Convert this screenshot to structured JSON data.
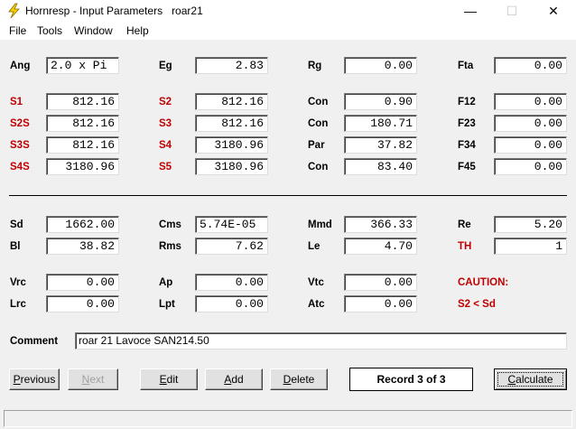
{
  "window": {
    "title": "Hornresp - Input Parameters   roar21",
    "minimize_glyph": "—",
    "maximize_glyph": "☐",
    "close_glyph": "✕",
    "icon": "lightning-bolt-icon"
  },
  "menu": [
    "File",
    "Tools",
    "Window",
    "Help"
  ],
  "labels": {
    "ang": "Ang",
    "eg": "Eg",
    "rg": "Rg",
    "fta": "Fta",
    "s1": "S1",
    "s2": "S2",
    "con1": "Con",
    "f12": "F12",
    "s2s": "S2S",
    "s3": "S3",
    "con2": "Con",
    "f23": "F23",
    "s3s": "S3S",
    "s4": "S4",
    "par": "Par",
    "f34": "F34",
    "s4s": "S4S",
    "s5": "S5",
    "con3": "Con",
    "f45": "F45",
    "sd": "Sd",
    "cms": "Cms",
    "mmd": "Mmd",
    "re": "Re",
    "bl": "Bl",
    "rms": "Rms",
    "le": "Le",
    "th": "TH",
    "vrc": "Vrc",
    "ap": "Ap",
    "vtc": "Vtc",
    "caution": "CAUTION:",
    "lrc": "Lrc",
    "lpt": "Lpt",
    "atc": "Atc",
    "warning": "S2 < Sd",
    "comment": "Comment"
  },
  "values": {
    "ang": "2.0 x Pi",
    "eg": "2.83",
    "rg": "0.00",
    "fta": "0.00",
    "s1": "812.16",
    "s2": "812.16",
    "con1": "0.90",
    "f12": "0.00",
    "s2s": "812.16",
    "s3": "812.16",
    "con2": "180.71",
    "f23": "0.00",
    "s3s": "812.16",
    "s4": "3180.96",
    "par": "37.82",
    "f34": "0.00",
    "s4s": "3180.96",
    "s5": "3180.96",
    "con3": "83.40",
    "f45": "0.00",
    "sd": "1662.00",
    "cms": "5.74E-05",
    "mmd": "366.33",
    "re": "5.20",
    "bl": "38.82",
    "rms": "7.62",
    "le": "4.70",
    "th": "1",
    "vrc": "0.00",
    "ap": "0.00",
    "vtc": "0.00",
    "lrc": "0.00",
    "lpt": "0.00",
    "atc": "0.00",
    "comment": "roar 21 Lavoce SAN214.50"
  },
  "buttons": {
    "previous_u": "P",
    "previous_rest": "revious",
    "next_u": "N",
    "next_rest": "ext",
    "edit_u": "E",
    "edit_rest": "dit",
    "add_u": "A",
    "add_rest": "dd",
    "delete_u": "D",
    "delete_rest": "elete",
    "calculate_u": "C",
    "calculate_rest": "alculate"
  },
  "record": "Record 3 of 3",
  "colors": {
    "red_label": "#c00000",
    "window_bg": "#f0f0f0"
  }
}
